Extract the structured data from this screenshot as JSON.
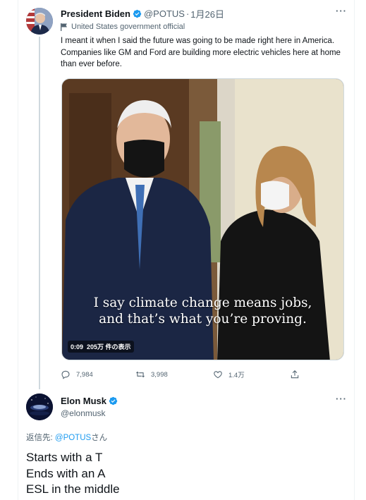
{
  "tweet1": {
    "display_name": "President Biden",
    "handle": "@POTUS",
    "separator": "·",
    "date": "1月26日",
    "more_label": "···",
    "gov_label": "United States government official",
    "text": "I meant it when I said the future was going to be made right here in America. Companies like GM and Ford are building more electric vehicles here at home than ever before.",
    "video": {
      "caption_line1": "I say climate change means jobs,",
      "caption_line2": "and that’s what you’re proving.",
      "duration": "0:09",
      "views": "205万 件の表示"
    },
    "actions": {
      "replies": "7,984",
      "retweets": "3,998",
      "likes": "1.4万"
    }
  },
  "tweet2": {
    "display_name": "Elon Musk",
    "handle": "@elonmusk",
    "more_label": "···",
    "reply_prefix": "返信先: ",
    "reply_link": "@POTUS",
    "reply_suffix": "さん",
    "text_lines": [
      "Starts with a T",
      "Ends with an A",
      "ESL in the middle"
    ]
  },
  "colors": {
    "accent": "#1d9bf0",
    "secondary_text": "#536471",
    "primary_text": "#0f1419"
  }
}
